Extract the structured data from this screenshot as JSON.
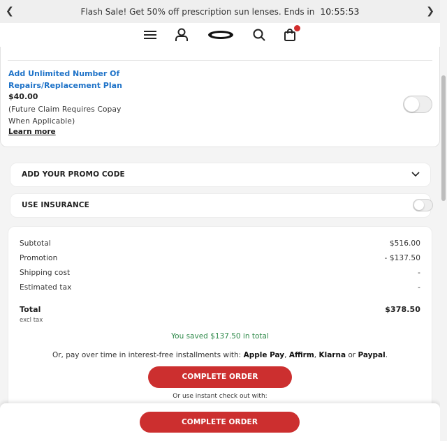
{
  "promo_bar": {
    "message": "Flash Sale! Get 50% off prescription sun lenses. Ends in",
    "timer": "10:55:53"
  },
  "icons": {
    "prev": "chevron-left-icon",
    "next": "chevron-right-icon",
    "menu": "hamburger-menu-icon",
    "account": "user-icon",
    "logo": "brand-logo",
    "search": "search-icon",
    "cart": "shopping-bag-icon",
    "promo_chevron": "chevron-down-icon"
  },
  "colors": {
    "accent_red": "#cc2f2f",
    "link_blue": "#1f73c8",
    "saved_green": "#2f8a4a"
  },
  "plan": {
    "title": "Add Unlimited Number Of Repairs/Replacement Plan",
    "price": "$40.00",
    "note": "(Future Claim Requires Copay When Applicable)",
    "learn_more": "Learn more",
    "toggle_on": false
  },
  "promo_code": {
    "label": "ADD YOUR PROMO CODE"
  },
  "insurance": {
    "label": "USE INSURANCE",
    "toggle_on": false
  },
  "summary": {
    "rows": [
      {
        "label": "Subtotal",
        "value": "$516.00"
      },
      {
        "label": "Promotion",
        "value": "- $137.50"
      },
      {
        "label": "Shipping cost",
        "value": "-"
      },
      {
        "label": "Estimated tax",
        "value": "-"
      }
    ],
    "total_label": "Total",
    "total_value": "$378.50",
    "excl_tax": "excl tax",
    "saved_text": "You saved $137.50 in total",
    "installments_prefix": "Or, pay over time in interest-free installments with:",
    "providers": [
      "Apple Pay",
      "Affirm",
      "Klarna",
      "Paypal"
    ],
    "sep_comma": ",",
    "sep_or": "or",
    "period": ".",
    "complete_order": "COMPLETE ORDER",
    "instant_checkout": "Or use instant check out with:"
  },
  "bottom_bar": {
    "complete_order": "COMPLETE ORDER"
  }
}
